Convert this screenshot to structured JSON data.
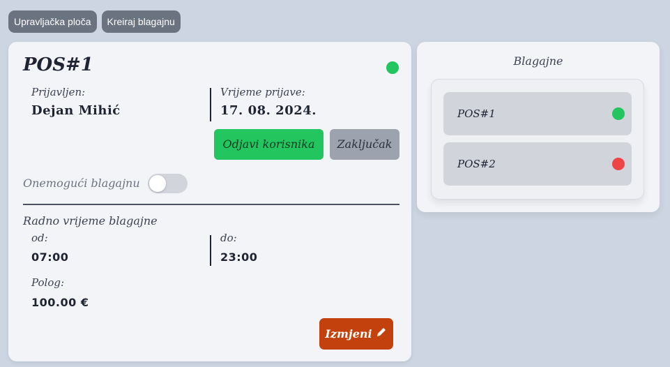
{
  "nav": {
    "dashboard_label": "Upravljačka ploča",
    "create_register_label": "Kreiraj blagajnu"
  },
  "pos": {
    "title": "POS#1",
    "status_color": "#22c55e",
    "logged_in_label": "Prijavljen:",
    "logged_in_user": "Dejan Mihić",
    "login_time_label": "Vrijeme prijave:",
    "login_date": "17. 08. 2024.",
    "logout_button": "Odjavi korisnika",
    "lock_button": "Zaključak",
    "disable_label": "Onemogući blagajnu",
    "disable_enabled": false,
    "working_hours_title": "Radno vrijeme blagajne",
    "from_label": "od:",
    "from_value": "07:00",
    "to_label": "do:",
    "to_value": "23:00",
    "deposit_label": "Polog:",
    "deposit_value": "100.00 €",
    "edit_button": "Izmjeni"
  },
  "registers": {
    "title": "Blagajne",
    "items": [
      {
        "name": "POS#1",
        "status_color": "#22c55e"
      },
      {
        "name": "POS#2",
        "status_color": "#ef4444"
      }
    ]
  },
  "colors": {
    "background": "#ccd5e1",
    "card": "#f3f4f7",
    "accent_green": "#22c55e",
    "accent_red": "#ef4444",
    "edit_orange": "#c2410c",
    "nav_gray": "#6b7280"
  },
  "icons": {
    "edit": "pencil-icon"
  }
}
